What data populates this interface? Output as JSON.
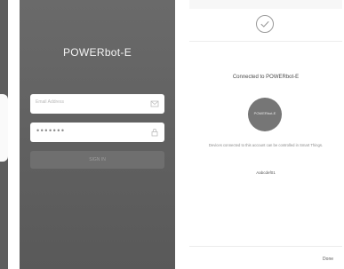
{
  "login_screen": {
    "title": "POWERbot-E",
    "email_placeholder": "Email Address",
    "password_mask": "•••••••",
    "sign_in_label": "SIGN IN",
    "email_icon": "envelope-icon",
    "password_icon": "lock-icon"
  },
  "connected_screen": {
    "heading": "Connected to POWERbot-E",
    "device_label": "POWERbot-E",
    "info_text": "Devices connected to this account can be controlled in Smart Things.",
    "code": "Aabcdef01",
    "done_label": "Done",
    "check_icon": "check-circle-icon"
  },
  "colors": {
    "login_background": "#626262",
    "button_background": "#6f6f6f",
    "device_circle": "#767676"
  }
}
